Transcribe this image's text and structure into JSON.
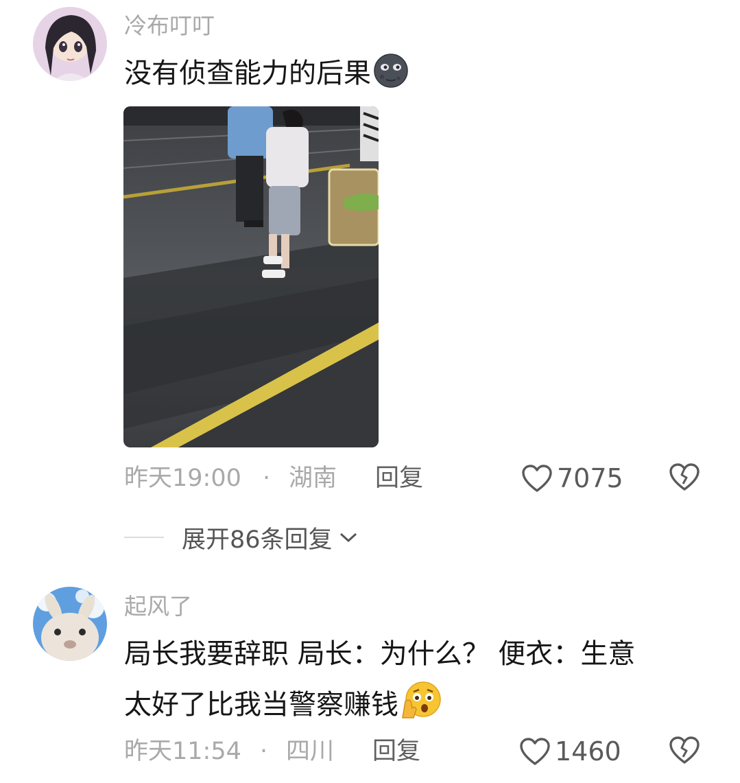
{
  "comments": [
    {
      "username": "冷布叮叮",
      "text": "没有侦查能力的后果",
      "emoji_icon": "new-moon-face-emoji",
      "time": "昨天19:00",
      "separator": "·",
      "location": "湖南",
      "reply_label": "回复",
      "likes": "7075"
    },
    {
      "username": "起风了",
      "text_line1": "局长我要辞职 局长：为什么？ 便衣：生意",
      "text_line2": "太好了比我当警察赚钱",
      "emoji_icon": "shushing-face-emoji",
      "time": "昨天11:54",
      "separator": "·",
      "location": "四川",
      "reply_label": "回复",
      "likes": "1460"
    }
  ],
  "expand_replies": {
    "label": "展开86条回复"
  }
}
